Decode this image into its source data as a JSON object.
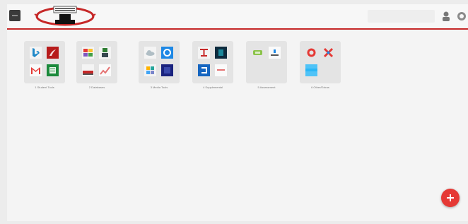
{
  "header": {
    "menu_icon": "hamburger-icon",
    "logo_icon": "portal-logo-icon",
    "user_icon": "user-icon",
    "help_icon": "help-icon"
  },
  "groups": [
    {
      "label": "1 Student Tools",
      "apps": [
        "bing-icon",
        "acrobat-icon",
        "gmail-icon",
        "sheets-icon"
      ]
    },
    {
      "label": "2 Databases",
      "apps": [
        "colorful-app-icon",
        "library-icon",
        "gallery-icon",
        "chart-icon"
      ]
    },
    {
      "label": "3 Media Tools",
      "apps": [
        "cloud-icon",
        "blue-gear-icon",
        "pinwheel-icon",
        "dark-app-icon"
      ]
    },
    {
      "label": "4 Supplemental",
      "apps": [
        "red-logo-icon",
        "dark-square-icon",
        "blue-square-icon",
        "white-card-icon"
      ]
    },
    {
      "label": "5 Assessment",
      "apps": [
        "green-app-icon",
        "document-icon"
      ]
    },
    {
      "label": "6 Other/Extras",
      "apps": [
        "lifebuoy-icon",
        "red-x-icon",
        "blue-bar-icon"
      ]
    }
  ],
  "fab": {
    "icon": "add-icon"
  }
}
